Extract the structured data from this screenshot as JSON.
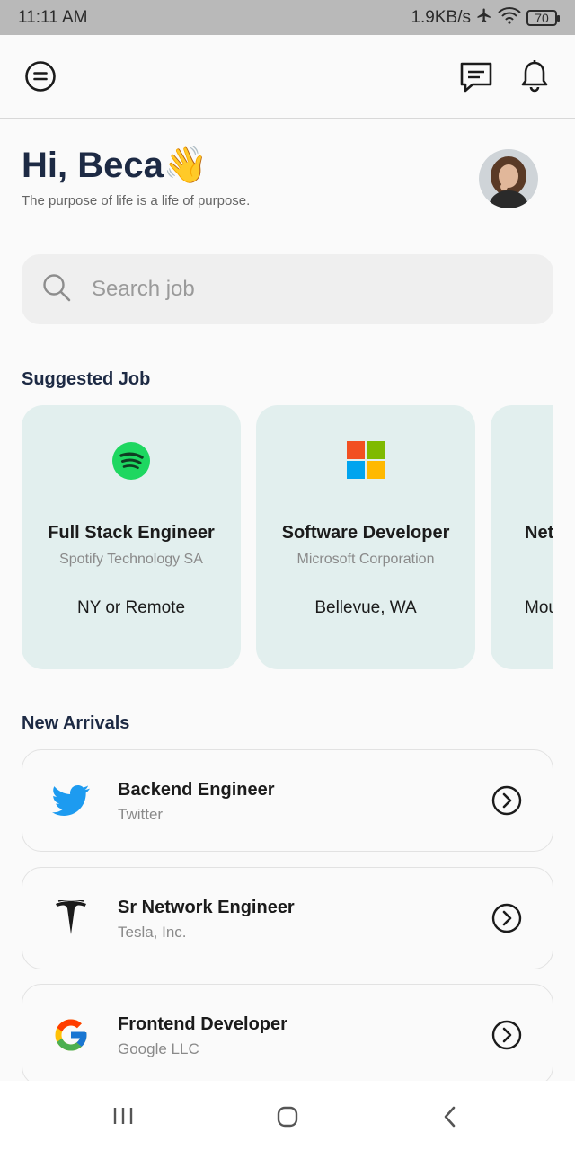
{
  "status_bar": {
    "time": "11:11 AM",
    "net_speed": "1.9KB/s",
    "battery": "70"
  },
  "header": {
    "menu_icon": "menu-circle-icon",
    "chat_icon": "chat-icon",
    "bell_icon": "bell-icon"
  },
  "greeting": {
    "title": "Hi, Beca👋",
    "tagline": "The purpose of life is a life of purpose."
  },
  "search": {
    "placeholder": "Search job"
  },
  "suggested": {
    "heading": "Suggested Job",
    "jobs": [
      {
        "title": "Full Stack Engineer",
        "company": "Spotify Technology SA",
        "location": "NY or Remote",
        "logo": "spotify-logo"
      },
      {
        "title": "Software Developer",
        "company": "Microsoft Corporation",
        "location": "Bellevue, WA",
        "logo": "microsoft-logo"
      },
      {
        "title": "Net",
        "company": "",
        "location": "Mou",
        "logo": ""
      }
    ]
  },
  "arrivals": {
    "heading": "New Arrivals",
    "items": [
      {
        "title": "Backend Engineer",
        "company": "Twitter",
        "logo": "twitter-logo"
      },
      {
        "title": "Sr Network Engineer",
        "company": "Tesla, Inc.",
        "logo": "tesla-logo"
      },
      {
        "title": "Frontend Developer",
        "company": "Google LLC",
        "logo": "google-logo"
      }
    ]
  },
  "colors": {
    "accent": "#1d2a44",
    "card_bg": "#e2efee",
    "spotify": "#1ed760",
    "twitter": "#1d9bf0"
  }
}
